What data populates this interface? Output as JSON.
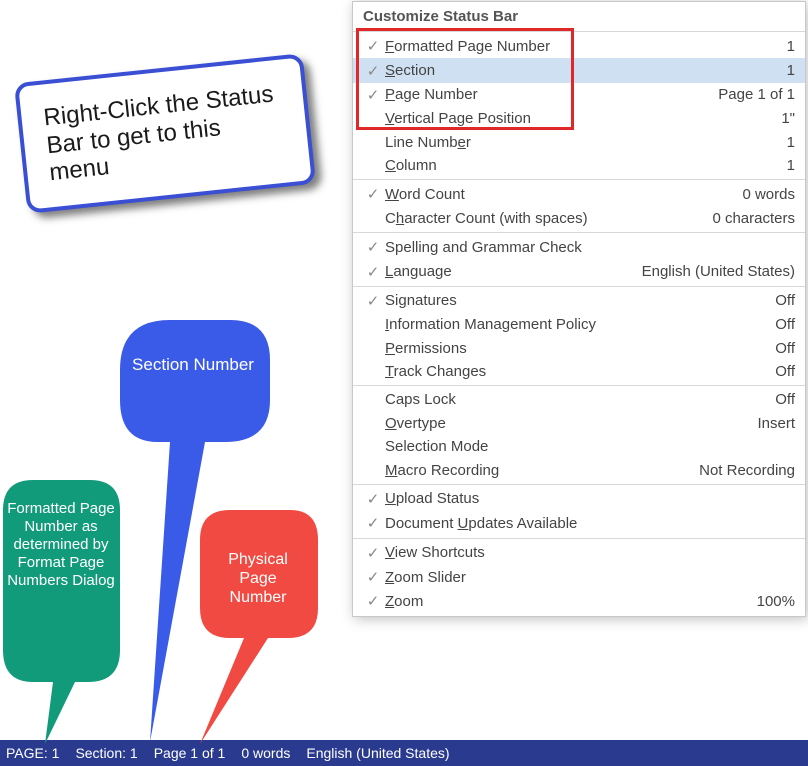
{
  "menu": {
    "header": "Customize Status Bar",
    "groups": [
      [
        {
          "checked": true,
          "pre": "F",
          "mid": "ormatted Page Number",
          "value": "1",
          "hovered": false
        },
        {
          "checked": true,
          "pre": "S",
          "mid": "ection",
          "value": "1",
          "hovered": true
        },
        {
          "checked": true,
          "pre": "P",
          "mid": "age Number",
          "value": "Page 1 of 1",
          "hovered": false
        },
        {
          "checked": false,
          "pre": "V",
          "mid": "ertical Page Position",
          "value": "1\"",
          "hovered": false
        },
        {
          "checked": false,
          "pre": "",
          "mid": "Line Numb",
          "accel2": "e",
          "post": "r",
          "value": "1",
          "hovered": false
        },
        {
          "checked": false,
          "pre": "C",
          "mid": "olumn",
          "value": "1",
          "hovered": false
        }
      ],
      [
        {
          "checked": true,
          "pre": "W",
          "mid": "ord Count",
          "value": "0 words"
        },
        {
          "checked": false,
          "pre": "",
          "mid": "C",
          "accel2": "h",
          "post": "aracter Count (with spaces)",
          "value": "0 characters"
        }
      ],
      [
        {
          "checked": true,
          "pre": "",
          "mid": "Spelling and Grammar Check",
          "value": ""
        },
        {
          "checked": true,
          "pre": "L",
          "mid": "anguage",
          "value": "English (United States)"
        }
      ],
      [
        {
          "checked": true,
          "pre": "",
          "mid": "Si",
          "accel2": "g",
          "post": "natures",
          "value": "Off"
        },
        {
          "checked": false,
          "pre": "I",
          "mid": "nformation Management Policy",
          "value": "Off"
        },
        {
          "checked": false,
          "pre": "P",
          "mid": "ermissions",
          "value": "Off"
        },
        {
          "checked": false,
          "pre": "T",
          "mid": "rack Changes",
          "value": "Off"
        }
      ],
      [
        {
          "checked": false,
          "pre": "",
          "mid": "Caps Lock",
          "value": "Off"
        },
        {
          "checked": false,
          "pre": "O",
          "mid": "vertype",
          "value": "Insert"
        },
        {
          "checked": false,
          "pre": "",
          "mid": "Selection Mode",
          "value": ""
        },
        {
          "checked": false,
          "pre": "M",
          "mid": "acro Recording",
          "value": "Not Recording"
        }
      ],
      [
        {
          "checked": true,
          "pre": "U",
          "mid": "pload Status",
          "value": ""
        },
        {
          "checked": true,
          "pre": "",
          "mid": "Document ",
          "accel2": "U",
          "post": "pdates Available",
          "value": ""
        }
      ],
      [
        {
          "checked": true,
          "pre": "V",
          "mid": "iew Shortcuts",
          "value": ""
        },
        {
          "checked": true,
          "pre": "Z",
          "mid": "oom Slider",
          "value": ""
        },
        {
          "checked": true,
          "pre": "Z",
          "mid": "oom",
          "value": "100%"
        }
      ]
    ]
  },
  "note": "Right-Click the Status Bar to get to this menu",
  "callouts": {
    "green": "Formatted Page Number as determined by Format Page Numbers Dialog",
    "blue": "Section Number",
    "red": "Physical Page Number"
  },
  "statusbar": {
    "page_label": "PAGE: 1",
    "section_label": "Section: 1",
    "pages_label": "Page 1 of 1",
    "words_label": "0 words",
    "language_label": "English (United States)"
  }
}
